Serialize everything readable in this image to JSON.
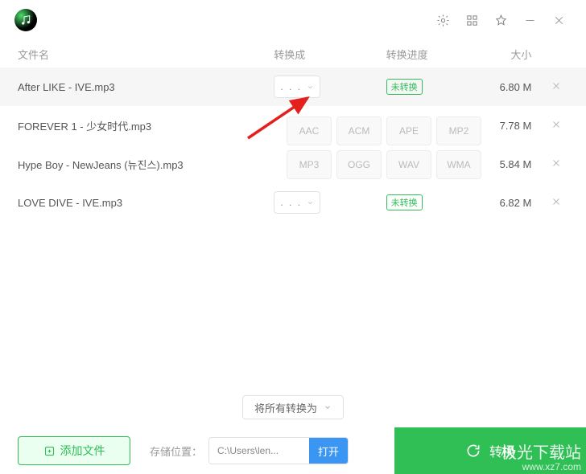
{
  "header": {
    "col_name": "文件名",
    "col_convert": "转换成",
    "col_progress": "转换进度",
    "col_size": "大小"
  },
  "rows": [
    {
      "name": "After LIKE - IVE.mp3",
      "dropdown_dots": ". . .",
      "badge": "未转换",
      "size": "6.80 M",
      "highlight": true
    },
    {
      "name": "FOREVER 1 - 少女时代.mp3",
      "dropdown_dots": "",
      "badge": "",
      "size": "7.78 M",
      "highlight": false
    },
    {
      "name": "Hype Boy - NewJeans (뉴진스).mp3",
      "dropdown_dots": "",
      "badge": "",
      "size": "5.84 M",
      "highlight": false
    },
    {
      "name": "LOVE DIVE - IVE.mp3",
      "dropdown_dots": ". . .",
      "badge": "未转换",
      "size": "6.82 M",
      "highlight": false
    }
  ],
  "formats": [
    "AAC",
    "ACM",
    "APE",
    "MP2",
    "MP3",
    "OGG",
    "WAV",
    "WMA"
  ],
  "convert_all_label": "将所有转换为",
  "bottom": {
    "add_file": "添加文件",
    "save_location_label": "存储位置：",
    "path": "C:\\Users\\len...",
    "open": "打开",
    "convert": "转换"
  },
  "watermark": {
    "line1": "极光下载站",
    "line2": "www.xz7.com"
  }
}
